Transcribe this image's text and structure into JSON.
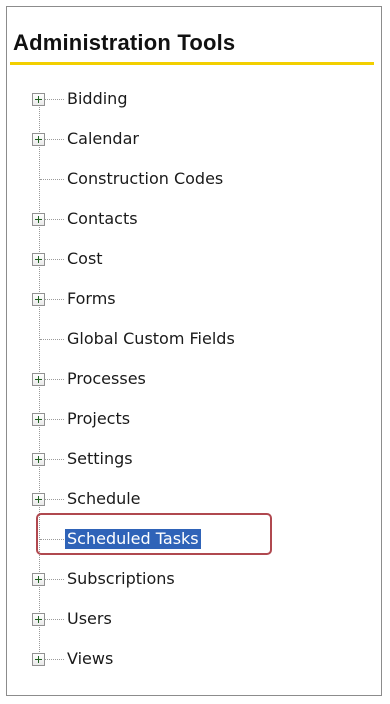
{
  "panel": {
    "title": "Administration Tools"
  },
  "tree": {
    "items": [
      {
        "label": "Bidding",
        "expandable": true,
        "selected": false
      },
      {
        "label": "Calendar",
        "expandable": true,
        "selected": false
      },
      {
        "label": "Construction Codes",
        "expandable": false,
        "selected": false
      },
      {
        "label": "Contacts",
        "expandable": true,
        "selected": false
      },
      {
        "label": "Cost",
        "expandable": true,
        "selected": false
      },
      {
        "label": "Forms",
        "expandable": true,
        "selected": false
      },
      {
        "label": "Global Custom Fields",
        "expandable": false,
        "selected": false
      },
      {
        "label": "Processes",
        "expandable": true,
        "selected": false
      },
      {
        "label": "Projects",
        "expandable": true,
        "selected": false
      },
      {
        "label": "Settings",
        "expandable": true,
        "selected": false
      },
      {
        "label": "Schedule",
        "expandable": true,
        "selected": false
      },
      {
        "label": "Scheduled Tasks",
        "expandable": false,
        "selected": true
      },
      {
        "label": "Subscriptions",
        "expandable": true,
        "selected": false
      },
      {
        "label": "Users",
        "expandable": true,
        "selected": false
      },
      {
        "label": "Views",
        "expandable": true,
        "selected": false
      }
    ]
  },
  "colors": {
    "title_rule": "#f2cf00",
    "selection_background": "#2f63b8",
    "callout_border": "#b0484f"
  },
  "icons": {
    "expander": "plus-box-icon"
  }
}
